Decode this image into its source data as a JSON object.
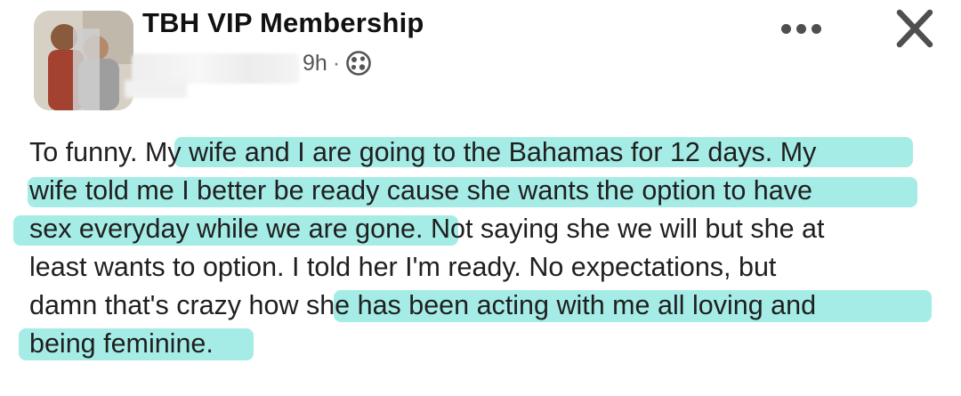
{
  "header": {
    "group_name": "TBH VIP Membership",
    "time": "9h",
    "separator": "·",
    "audience_icon": "globe-icon",
    "more_icon": "more-options-icon",
    "close_icon": "close-icon"
  },
  "post": {
    "lines": [
      "To funny. My wife and I are going to the Bahamas for 12 days. My",
      "wife told me I better be ready cause she wants the option to have",
      "sex everyday while we are gone. Not saying she we will but she at",
      "least wants to option. I told her I'm ready. No expectations, but",
      "damn that's crazy how she has been acting with me all loving and",
      "being feminine."
    ]
  },
  "colors": {
    "highlight": "#6EE1D7",
    "text": "#1F1F1F",
    "meta": "#555555",
    "icon": "#4F4F4F"
  }
}
